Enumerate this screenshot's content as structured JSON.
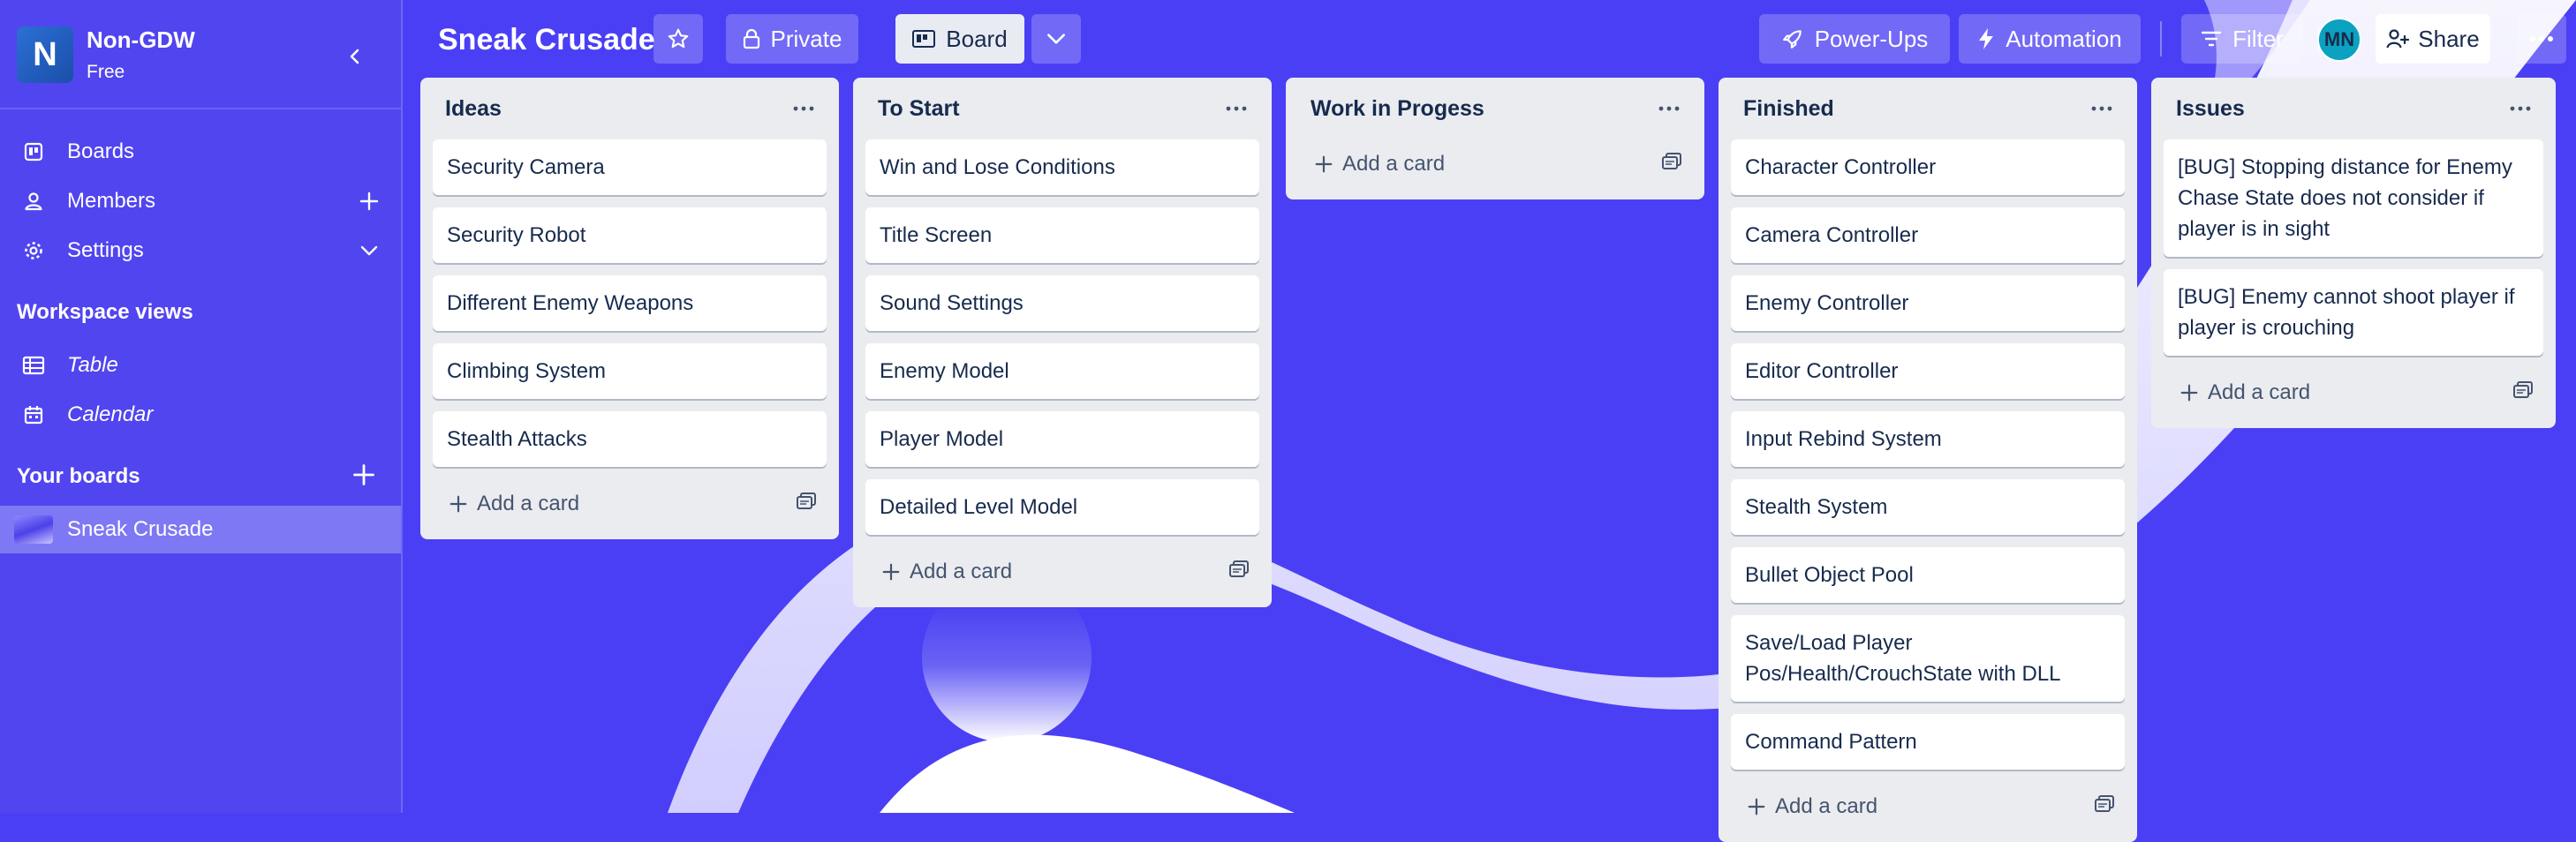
{
  "workspace": {
    "initial": "N",
    "name": "Non-GDW",
    "plan": "Free"
  },
  "sidebar": {
    "nav": [
      {
        "label": "Boards",
        "icon": "board-icon"
      },
      {
        "label": "Members",
        "icon": "person-icon"
      },
      {
        "label": "Settings",
        "icon": "gear-icon"
      }
    ],
    "workspace_views_heading": "Workspace views",
    "views": [
      {
        "label": "Table",
        "icon": "table-icon"
      },
      {
        "label": "Calendar",
        "icon": "calendar-icon"
      }
    ],
    "your_boards_heading": "Your boards",
    "boards": [
      {
        "label": "Sneak Crusade"
      }
    ]
  },
  "header": {
    "title": "Sneak Crusade",
    "visibility_label": "Private",
    "view_label": "Board",
    "powerups_label": "Power-Ups",
    "automation_label": "Automation",
    "filter_label": "Filter",
    "avatar_initials": "MN",
    "share_label": "Share"
  },
  "add_card_label": "Add a card",
  "lists": [
    {
      "title": "Ideas",
      "cards": [
        "Security Camera",
        "Security Robot",
        "Different Enemy Weapons",
        "Climbing System",
        "Stealth Attacks"
      ]
    },
    {
      "title": "To Start",
      "cards": [
        "Win and Lose Conditions",
        "Title Screen",
        "Sound Settings",
        "Enemy Model",
        "Player Model",
        "Detailed Level Model"
      ]
    },
    {
      "title": "Work in Progess",
      "cards": []
    },
    {
      "title": "Finished",
      "cards": [
        "Character Controller",
        "Camera Controller",
        "Enemy Controller",
        "Editor Controller",
        "Input Rebind System",
        "Stealth System",
        "Bullet Object Pool",
        "Save/Load Player Pos/Health/CrouchState with DLL",
        "Command Pattern"
      ]
    },
    {
      "title": "Issues",
      "cards": [
        "[BUG] Stopping distance for Enemy Chase State does not consider if player is in sight",
        "[BUG] Enemy cannot shoot player if player is crouching"
      ]
    }
  ],
  "colors": {
    "sidebar": "#5145ef",
    "board_bg": "#4b3ff5",
    "list_bg": "#ebecf0",
    "text": "#172b4d"
  }
}
